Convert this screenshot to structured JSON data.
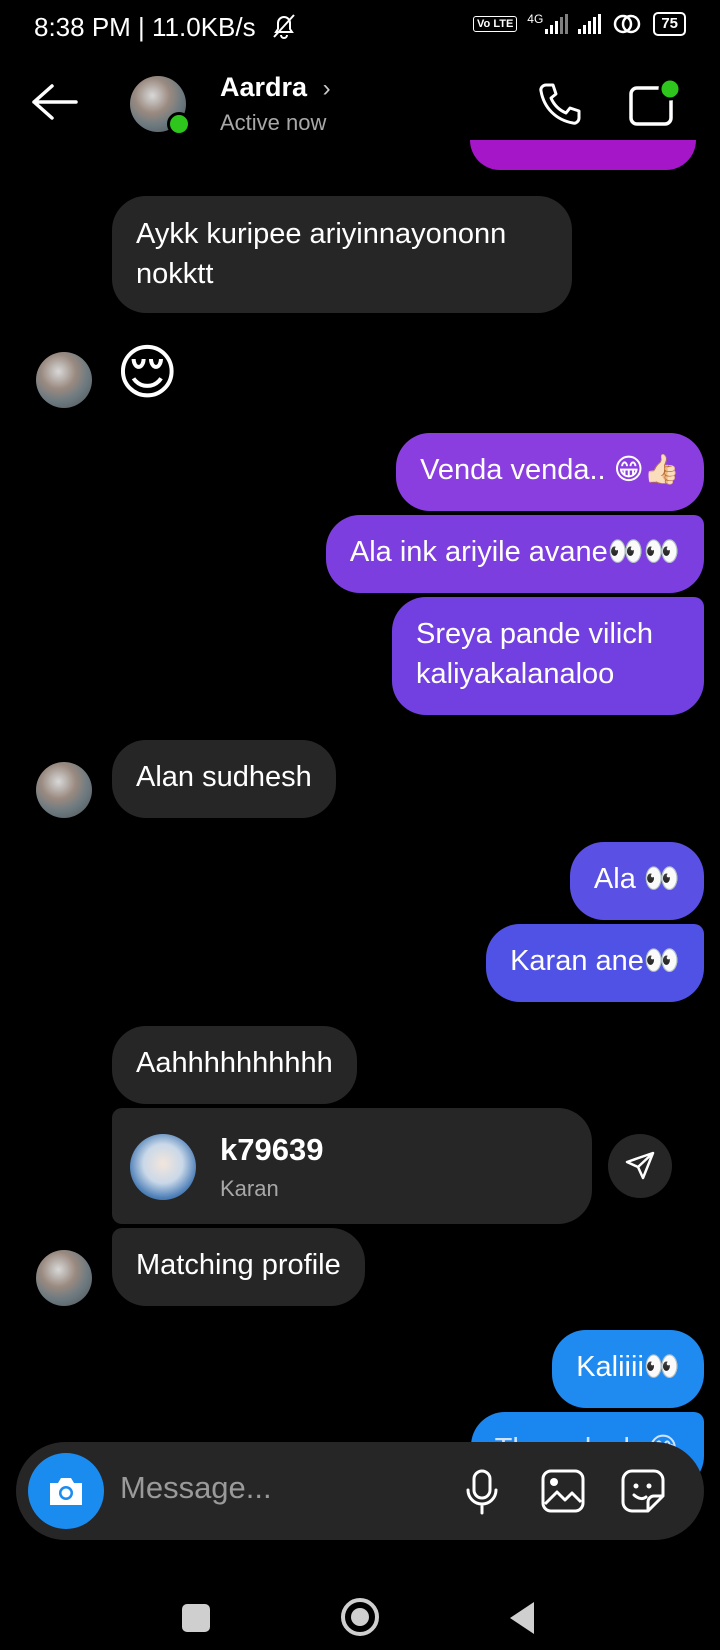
{
  "status_bar": {
    "time": "8:38 PM | 11.0KB/s",
    "volte": "Vo LTE",
    "network": "4G",
    "battery": "75"
  },
  "header": {
    "contact_name": "Aardra",
    "chevron": "›",
    "status": "Active now",
    "icons": [
      "back-arrow-icon",
      "avatar",
      "call-icon",
      "video-call-icon"
    ]
  },
  "messages": [
    {
      "side": "in",
      "text": "Aykk kuripee ariyinnayononn\nnokktt"
    },
    {
      "side": "in",
      "text": "😌",
      "type": "emoji"
    },
    {
      "side": "out",
      "text": "Venda venda.. 😁👍🏻"
    },
    {
      "side": "out",
      "text": "Ala ink ariyile avane👀👀"
    },
    {
      "side": "out",
      "text": "Sreya pande vilich\nkaliyakalanaloo"
    },
    {
      "side": "in",
      "text": "Alan sudhesh"
    },
    {
      "side": "out",
      "text": "Ala 👀"
    },
    {
      "side": "out",
      "text": "Karan ane👀"
    },
    {
      "side": "in",
      "text": "Aahhhhhhhhhh"
    },
    {
      "side": "in",
      "type": "profile",
      "username": "k79639",
      "name": "Karan"
    },
    {
      "side": "in",
      "text": "Matching profile"
    },
    {
      "side": "out",
      "text": "Kaliiii👀"
    },
    {
      "side": "out",
      "text": "Th... ...k...k 😂"
    }
  ],
  "composer": {
    "placeholder": "Message..."
  },
  "colors": {
    "incoming_bubble": "#262626",
    "outgoing_purple": "#7a3fe0",
    "outgoing_indigo": "#5b4fe0",
    "outgoing_blue": "#1f8af0",
    "online": "#2ec51d",
    "camera_button": "#1a8cf0"
  }
}
